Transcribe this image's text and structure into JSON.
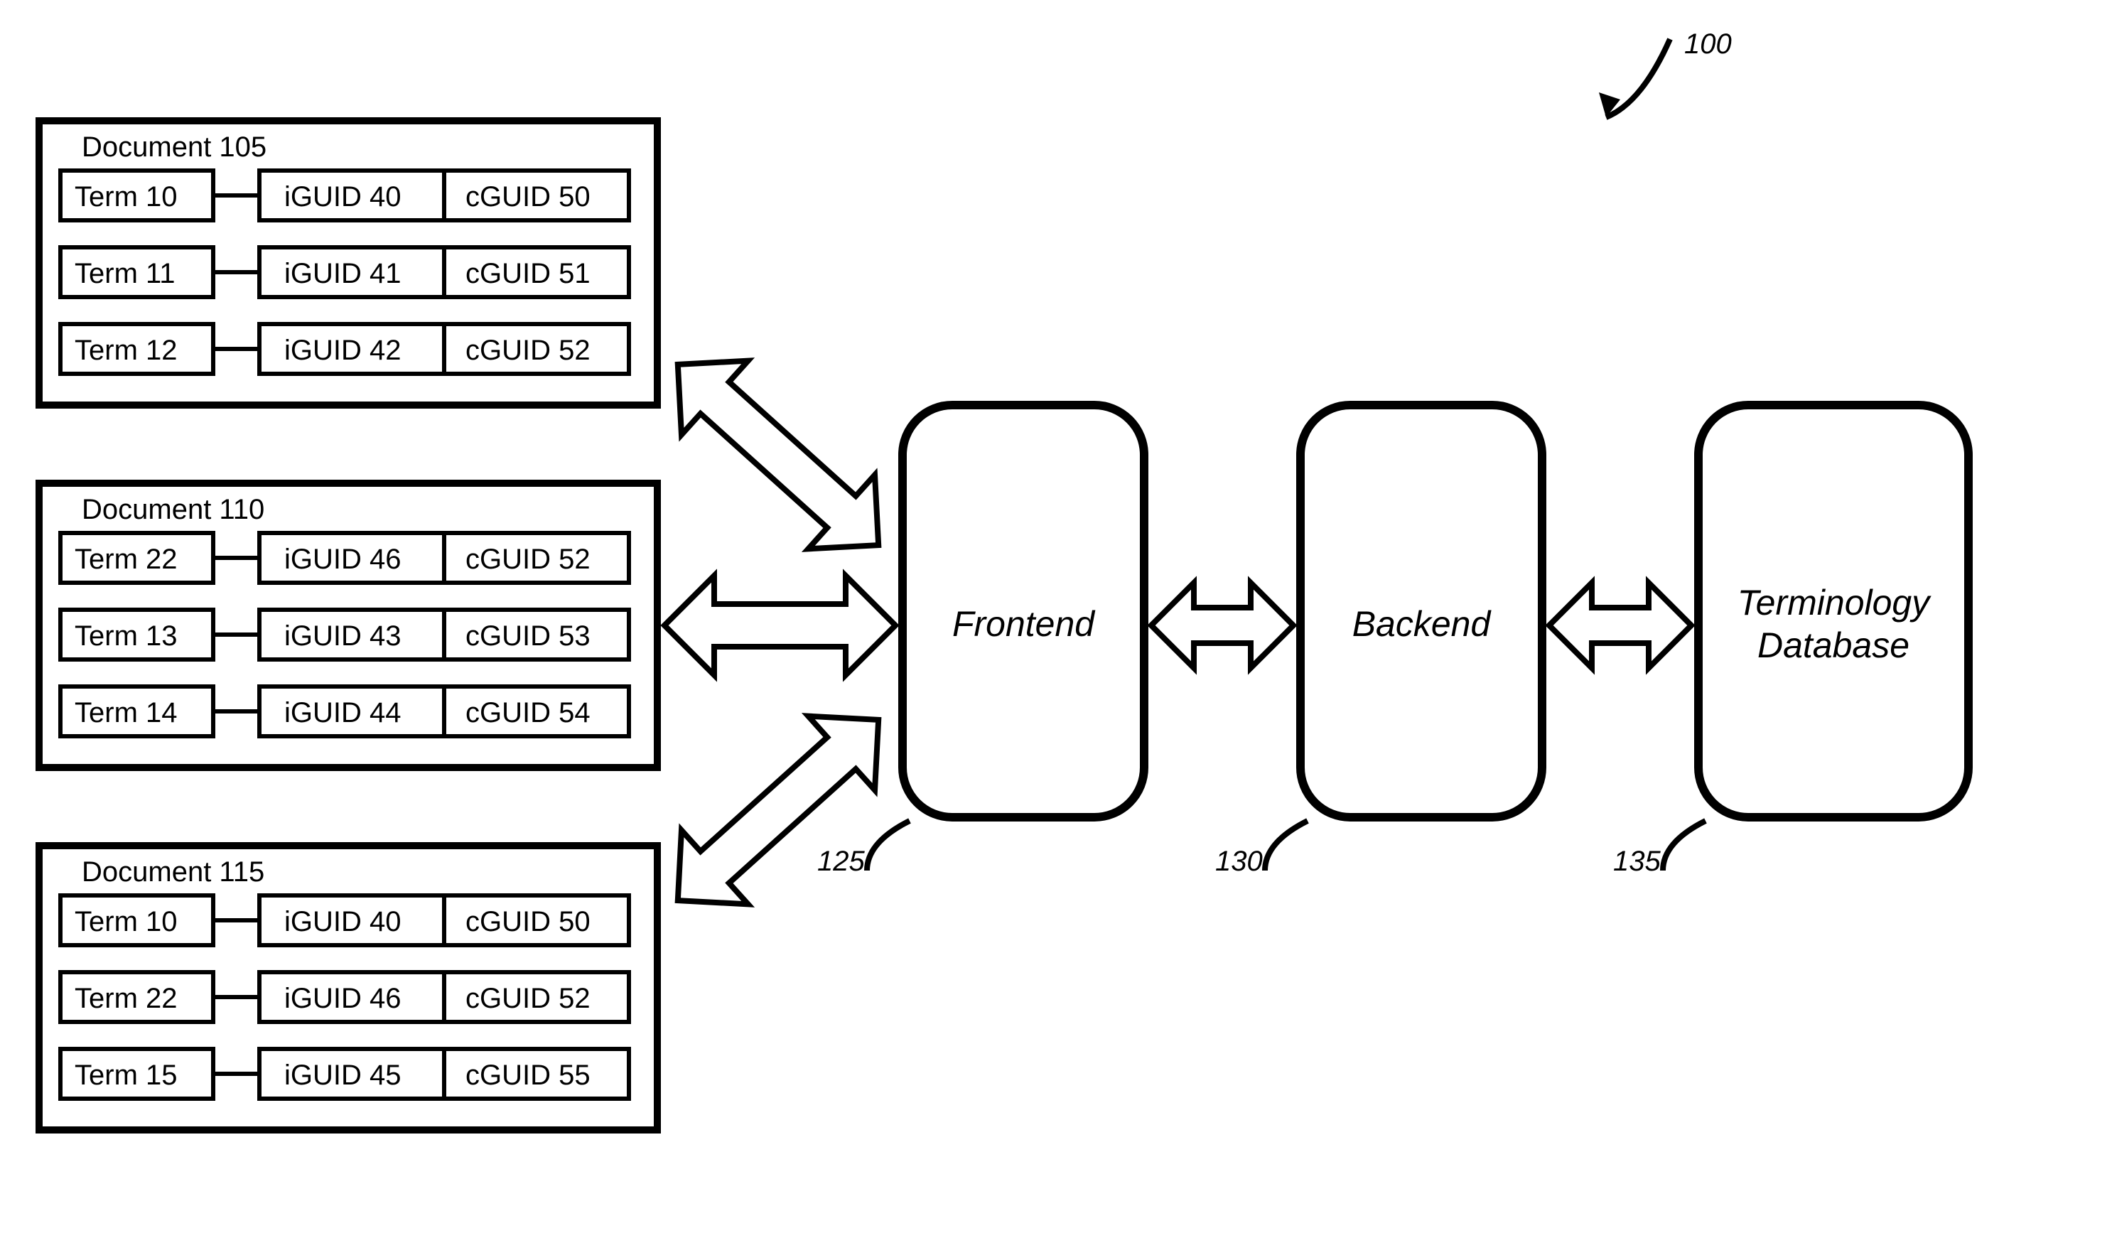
{
  "figure_ref": "100",
  "documents": [
    {
      "title": "Document 105",
      "rows": [
        {
          "term": "Term 10",
          "iguid": "iGUID 40",
          "cguid": "cGUID 50"
        },
        {
          "term": "Term 11",
          "iguid": "iGUID 41",
          "cguid": "cGUID 51"
        },
        {
          "term": "Term 12",
          "iguid": "iGUID 42",
          "cguid": "cGUID 52"
        }
      ]
    },
    {
      "title": "Document 110",
      "rows": [
        {
          "term": "Term 22",
          "iguid": "iGUID 46",
          "cguid": "cGUID 52"
        },
        {
          "term": "Term 13",
          "iguid": "iGUID 43",
          "cguid": "cGUID 53"
        },
        {
          "term": "Term 14",
          "iguid": "iGUID 44",
          "cguid": "cGUID 54"
        }
      ]
    },
    {
      "title": "Document 115",
      "rows": [
        {
          "term": "Term 10",
          "iguid": "iGUID 40",
          "cguid": "cGUID 50"
        },
        {
          "term": "Term 22",
          "iguid": "iGUID 46",
          "cguid": "cGUID 52"
        },
        {
          "term": "Term 15",
          "iguid": "iGUID 45",
          "cguid": "cGUID 55"
        }
      ]
    }
  ],
  "nodes": {
    "frontend": {
      "label": "Frontend",
      "ref": "125"
    },
    "backend": {
      "label": "Backend",
      "ref": "130"
    },
    "database": {
      "label_line1": "Terminology",
      "label_line2": "Database",
      "ref": "135"
    }
  }
}
